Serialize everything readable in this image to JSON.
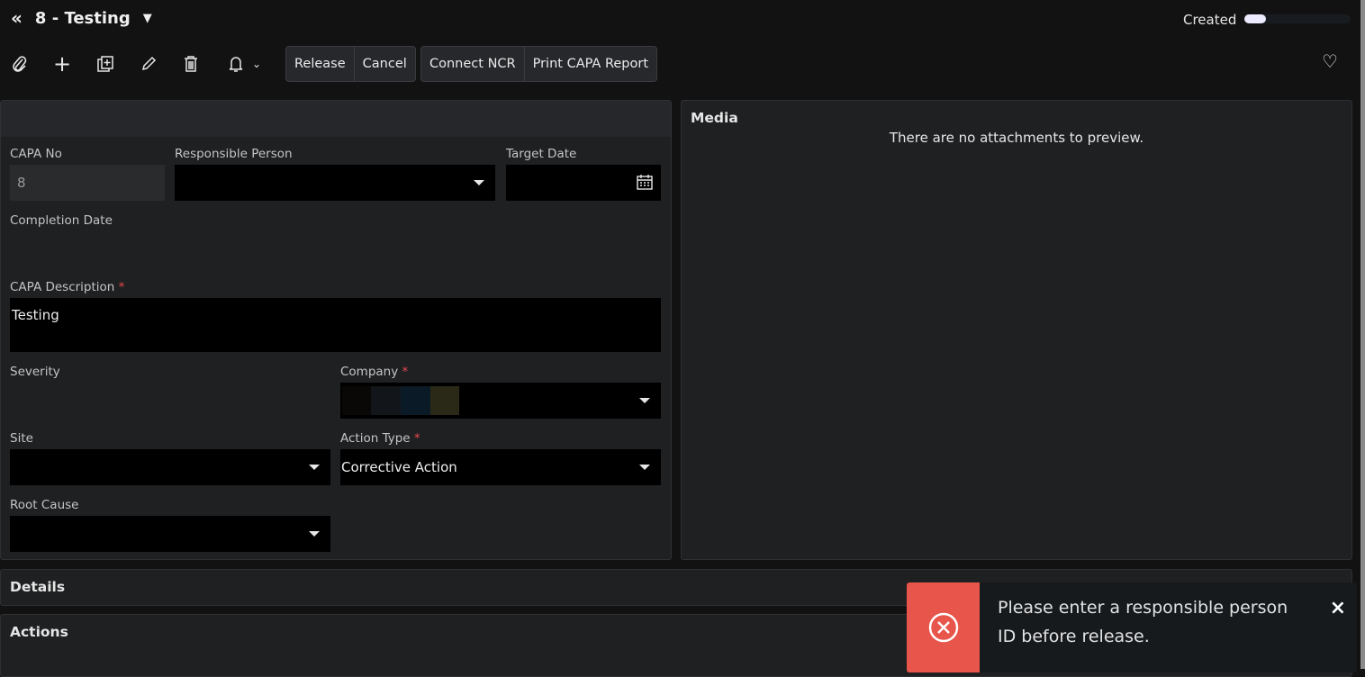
{
  "header": {
    "title": "8 - Testing",
    "status": "Created",
    "status_progress_percent": 20
  },
  "toolbar": {
    "release": "Release",
    "cancel": "Cancel",
    "connect_ncr": "Connect NCR",
    "print_report": "Print CAPA Report"
  },
  "form": {
    "capa_no_label": "CAPA No",
    "capa_no_value": "8",
    "responsible_person_label": "Responsible Person",
    "target_date_label": "Target Date",
    "completion_date_label": "Completion Date",
    "capa_description_label": "CAPA Description",
    "capa_description_value": "Testing",
    "severity_label": "Severity",
    "company_label": "Company",
    "site_label": "Site",
    "action_type_label": "Action Type",
    "action_type_value": "Corrective Action",
    "root_cause_label": "Root Cause",
    "required_mark": "*"
  },
  "media": {
    "title": "Media",
    "empty_text": "There are no attachments to preview."
  },
  "sections": {
    "details": "Details",
    "actions": "Actions"
  },
  "toast": {
    "message": "Please enter a responsible person ID before release.",
    "close": "×",
    "color": "#e8554a"
  }
}
